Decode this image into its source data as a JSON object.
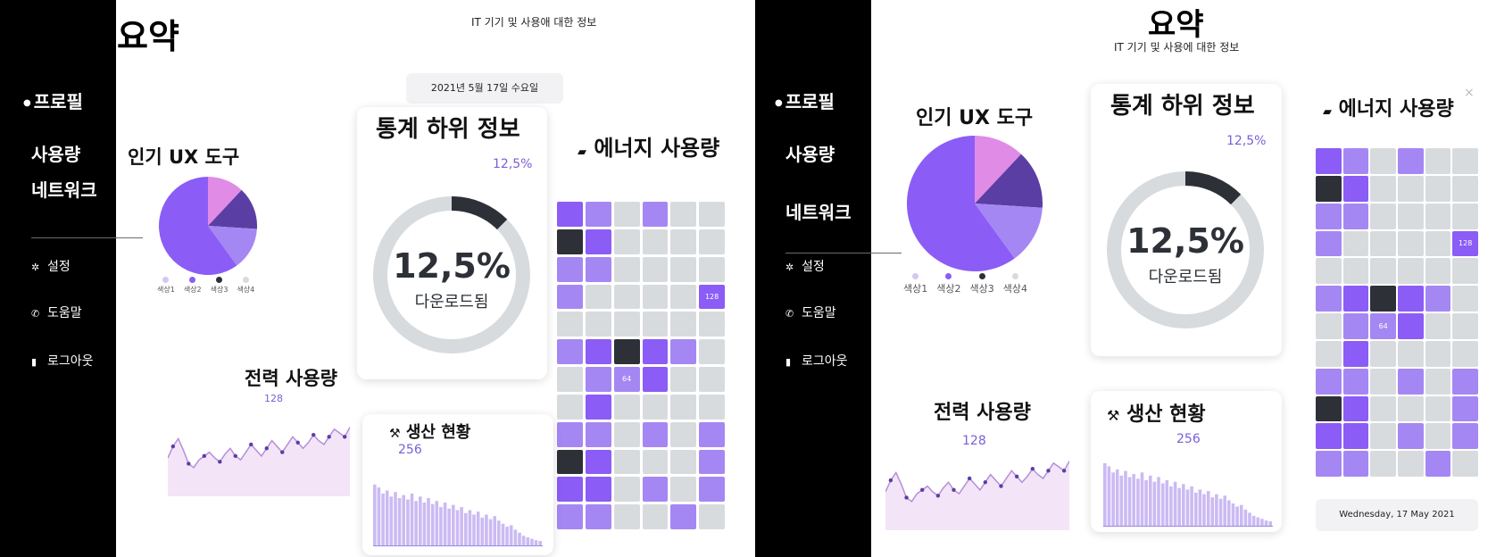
{
  "sidebar": {
    "profile": "프로필",
    "usage": "사용량",
    "network": "네트워크",
    "settings": "설정",
    "help": "도움말",
    "logout": "로그아웃"
  },
  "header": {
    "title": "요약",
    "subtitle_a": "IT 기기 및 사용애 대한 정보",
    "subtitle_b": "IT 기기 및 사용에 대한 정보",
    "date_ko": "2021년 5월 17일 수요일",
    "date_en": "Wednesday, 17 May 2021"
  },
  "cards": {
    "ux_tools": "인기 UX 도구",
    "stats": "통계 하위 정보",
    "stats_percent": "12,5%",
    "stats_big": "12,5%",
    "stats_caption": "다운로드됨",
    "energy": "에너지 사용량",
    "power": "전력 사용량",
    "power_value": "128",
    "production": "생산 현황",
    "production_value": "256"
  },
  "icons": {
    "profile": "profile-icon",
    "settings": "gear-icon",
    "help": "phone-icon",
    "logout": "door-icon",
    "energy": "folder-icon",
    "production": "tools-icon",
    "close": "close-icon"
  },
  "colors": {
    "primary": "#8b5cf6",
    "pink": "#e08be6",
    "dark_purple": "#5b3ea3",
    "medium_purple": "#a587f4",
    "light_purple": "#c7b3f6",
    "dark": "#2d3137",
    "gray": "#d8dbdd",
    "area_fill": "#f3e4f7"
  },
  "legend": [
    "색상1",
    "색상2",
    "색상3",
    "색상4"
  ],
  "legend_colors": [
    "#d5c7f2",
    "#8b5cf6",
    "#2d3137",
    "#d8dbdd"
  ],
  "chart_data": [
    {
      "type": "pie",
      "title": "인기 UX 도구",
      "categories": [
        "색상1",
        "색상2",
        "색상3",
        "색상4"
      ],
      "values": [
        60,
        12,
        14,
        14
      ]
    },
    {
      "type": "pie",
      "title": "통계 하위 정보",
      "categories": [
        "다운로드됨",
        "나머지"
      ],
      "values": [
        12.5,
        87.5
      ]
    },
    {
      "type": "area",
      "title": "전력 사용량",
      "x": [
        1,
        2,
        3,
        4,
        5,
        6,
        7,
        8,
        9,
        10,
        11,
        12,
        13,
        14,
        15,
        16,
        17,
        18,
        19,
        20,
        21,
        22,
        23,
        24,
        25,
        26,
        27,
        28,
        29,
        30,
        31,
        32,
        33,
        34,
        35,
        36
      ],
      "values": [
        40,
        52,
        60,
        48,
        34,
        30,
        38,
        42,
        46,
        40,
        36,
        44,
        50,
        42,
        38,
        46,
        54,
        48,
        42,
        50,
        58,
        52,
        46,
        54,
        62,
        56,
        50,
        56,
        64,
        58,
        54,
        62,
        70,
        66,
        62,
        72
      ]
    },
    {
      "type": "bar",
      "title": "생산 현황",
      "x": [
        1,
        2,
        3,
        4,
        5,
        6,
        7,
        8,
        9,
        10,
        11,
        12,
        13,
        14,
        15,
        16,
        17,
        18,
        19,
        20,
        21,
        22,
        23,
        24,
        25,
        26,
        27,
        28,
        29,
        30,
        31,
        32,
        33,
        34,
        35,
        36,
        37,
        38,
        39,
        40,
        41
      ],
      "values": [
        82,
        78,
        70,
        74,
        66,
        72,
        64,
        68,
        62,
        70,
        60,
        66,
        58,
        64,
        56,
        60,
        52,
        58,
        50,
        55,
        48,
        52,
        44,
        48,
        42,
        46,
        38,
        42,
        36,
        40,
        34,
        30,
        26,
        28,
        22,
        18,
        14,
        12,
        10,
        8,
        7
      ]
    },
    {
      "type": "heatmap",
      "title": "에너지 사용량",
      "rows": 12,
      "cols": 6,
      "levels": [
        [
          3,
          2,
          0,
          2,
          0,
          0
        ],
        [
          4,
          3,
          0,
          0,
          0,
          0
        ],
        [
          2,
          2,
          0,
          0,
          0,
          0
        ],
        [
          2,
          0,
          0,
          0,
          0,
          3
        ],
        [
          0,
          0,
          0,
          0,
          0,
          0
        ],
        [
          2,
          3,
          4,
          3,
          2,
          0
        ],
        [
          0,
          2,
          2,
          3,
          0,
          0
        ],
        [
          0,
          3,
          0,
          0,
          0,
          0
        ],
        [
          2,
          2,
          0,
          2,
          0,
          2
        ],
        [
          4,
          3,
          0,
          0,
          0,
          2
        ],
        [
          3,
          3,
          0,
          2,
          0,
          2
        ],
        [
          2,
          2,
          0,
          0,
          2,
          0
        ]
      ],
      "labels": [
        {
          "row": 3,
          "col": 5,
          "text": "128"
        },
        {
          "row": 6,
          "col": 2,
          "text": "64"
        }
      ]
    }
  ]
}
